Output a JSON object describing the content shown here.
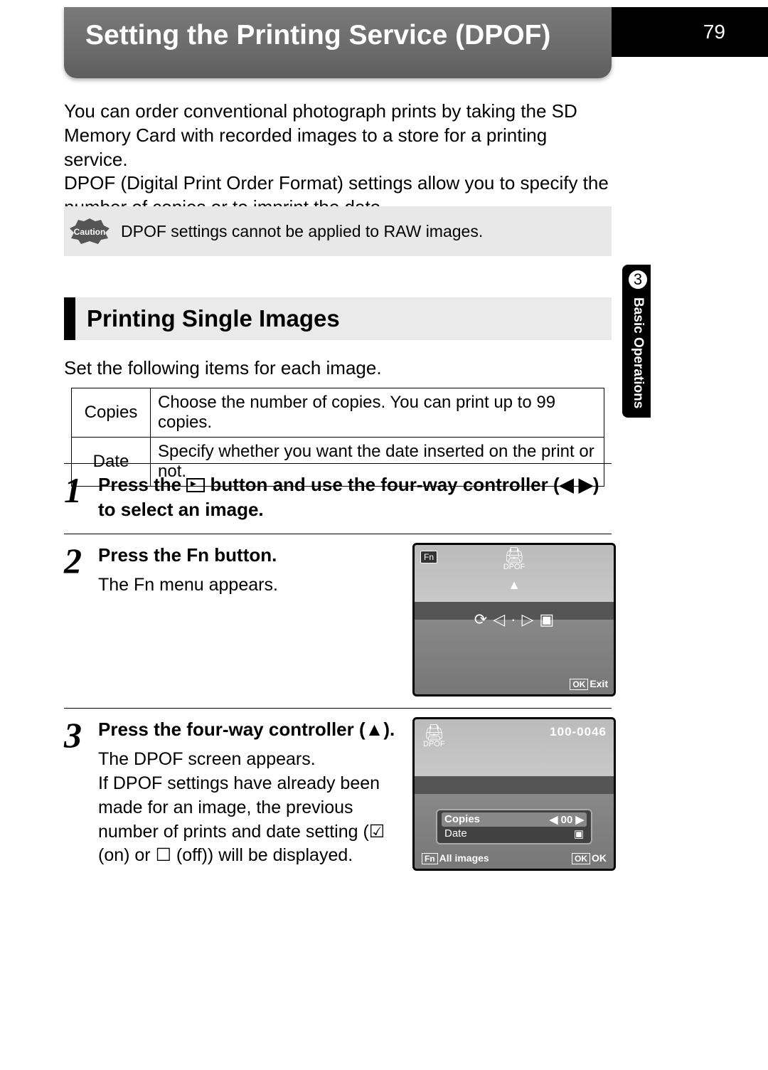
{
  "page_number": "79",
  "side": {
    "chapter_number": "3",
    "chapter_label": "Basic Operations"
  },
  "title": "Setting the Printing Service (DPOF)",
  "intro": "You can order conventional photograph prints by taking the SD Memory Card with recorded images to a store for a printing service.\nDPOF (Digital Print Order Format) settings allow you to specify the number of copies or to imprint the date.",
  "caution": {
    "label": "Caution",
    "text": "DPOF settings cannot be applied to RAW images."
  },
  "section_heading": "Printing Single Images",
  "section_body": "Set the following items for each image.",
  "settings_table": {
    "rows": [
      {
        "name": "Copies",
        "desc": "Choose the number of copies. You can print up to 99 copies."
      },
      {
        "name": "Date",
        "desc": "Specify whether you want the date inserted on the print or not."
      }
    ]
  },
  "steps": [
    {
      "num": "1",
      "title_parts": {
        "before_icon": "Press the ",
        "after_icon": " button and use the four-way controller (◀ ▶) to select an image."
      }
    },
    {
      "num": "2",
      "title": "Press the Fn button.",
      "body": "The Fn menu appears.",
      "screen": {
        "fn_label": "Fn",
        "dpof_label": "DPOF",
        "ok_label": "OK",
        "exit_label": "Exit"
      }
    },
    {
      "num": "3",
      "title": "Press the four-way controller (▲).",
      "body": "The DPOF screen appears.\nIf DPOF settings have already been made for an image, the previous number of prints and date setting (☑ (on) or ☐ (off)) will be displayed.",
      "screen": {
        "dpof_label": "DPOF",
        "file_number": "100-0046",
        "copies_label": "Copies",
        "copies_value": "00",
        "date_label": "Date",
        "fn_label": "Fn",
        "all_images_label": "All images",
        "ok_label": "OK",
        "ok_action": "OK"
      }
    }
  ]
}
